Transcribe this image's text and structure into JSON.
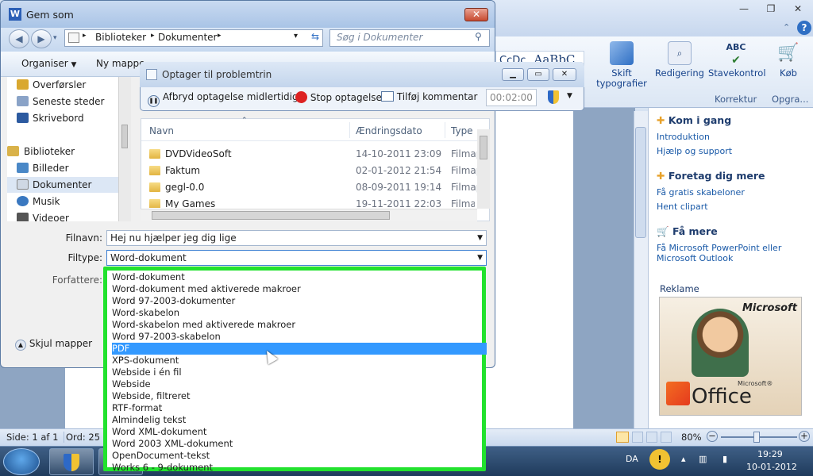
{
  "word": {
    "ribbon": {
      "styles_preview": [
        "CcDc",
        "AaBbC"
      ],
      "change_styles": "Skift typografier",
      "editing": "Redigering",
      "spelling": "Stavekontrol",
      "spelling_icon_text": "ABC",
      "buy": "Køb",
      "group_proofing": "Korrektur",
      "group_upgrade": "Opgra..."
    },
    "task_pane": {
      "section1": {
        "title": "Kom i gang",
        "links": [
          "Introduktion",
          "Hjælp og support"
        ]
      },
      "section2": {
        "title": "Foretag dig mere",
        "links": [
          "Få gratis skabeloner",
          "Hent clipart"
        ]
      },
      "section3": {
        "title": "Få mere",
        "links": [
          "Få Microsoft PowerPoint eller",
          "Microsoft Outlook"
        ]
      },
      "ad_label": "Reklame",
      "ad_brand": "Microsoft",
      "ad_product": "Office",
      "ad_product_super": "Microsoft®"
    },
    "status": {
      "page": "Side: 1 af 1",
      "words": "Ord: 25",
      "zoom": "80%",
      "zoom_value": 0.8
    }
  },
  "dialog": {
    "title": "Gem som",
    "app_icon_letter": "W",
    "close": "✕",
    "breadcrumb": [
      "Biblioteker",
      "Dokumenter"
    ],
    "search_placeholder": "Søg i Dokumenter",
    "toolbar": {
      "organize": "Organiser",
      "new_folder": "Ny mappe"
    },
    "nav": [
      "Overførsler",
      "Seneste steder",
      "Skrivebord",
      "Biblioteker",
      "Billeder",
      "Dokumenter",
      "Musik",
      "Videoer"
    ],
    "columns": {
      "name": "Navn",
      "date": "Ændringsdato",
      "type": "Type"
    },
    "files": [
      {
        "name": "DVDVideoSoft",
        "date": "14-10-2011 23:09",
        "type": "Filmap"
      },
      {
        "name": "Faktum",
        "date": "02-01-2012 21:54",
        "type": "Filmap"
      },
      {
        "name": "gegl-0.0",
        "date": "08-09-2011 19:14",
        "type": "Filmap"
      },
      {
        "name": "My Games",
        "date": "19-11-2011 22:03",
        "type": "Filmap"
      }
    ],
    "filename_label": "Filnavn:",
    "filename_value": "Hej nu hjælper jeg dig lige",
    "filetype_label": "Filtype:",
    "filetype_value": "Word-dokument",
    "authors_label": "Forfattere:",
    "hide_folders": "Skjul mapper"
  },
  "filetypes": [
    "Word-dokument",
    "Word-dokument med aktiverede makroer",
    "Word 97-2003-dokumenter",
    "Word-skabelon",
    "Word-skabelon med aktiverede makroer",
    "Word 97-2003-skabelon",
    "PDF",
    "XPS-dokument",
    "Webside i én fil",
    "Webside",
    "Webside, filtreret",
    "RTF-format",
    "Almindelig tekst",
    "Word XML-dokument",
    "Word 2003 XML-dokument",
    "OpenDocument-tekst",
    "Works 6 - 9-dokument"
  ],
  "filetypes_selected_index": 6,
  "recorder": {
    "title": "Optager til problemtrin",
    "pause": "Afbryd optagelse midlertidigt",
    "stop": "Stop optagelse",
    "comment": "Tilføj kommentar",
    "timer": "00:02:00"
  },
  "taskbar": {
    "language": "DA",
    "time": "19:29",
    "date": "10-01-2012"
  }
}
